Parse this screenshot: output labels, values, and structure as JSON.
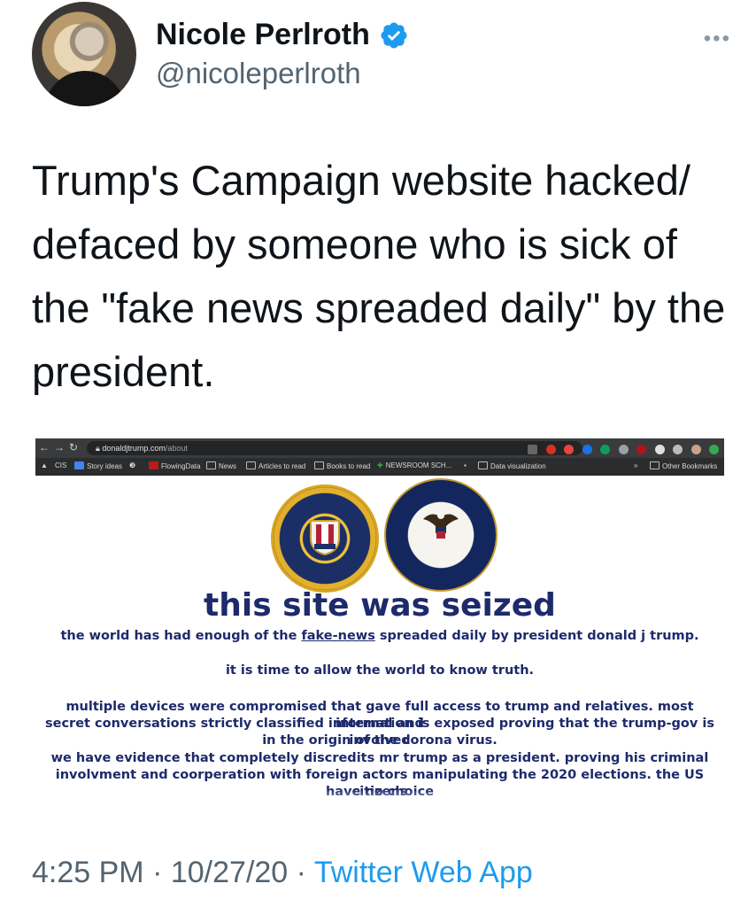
{
  "author": {
    "display_name": "Nicole Perlroth",
    "handle": "@nicoleperlroth",
    "verified": true,
    "more_menu": "•••"
  },
  "tweet": {
    "text": "Trump's Campaign website hacked/ defaced by someone who is sick of the \"fake news spreaded daily\" by the president.",
    "time": "4:25 PM",
    "date": "10/27/20",
    "separator": "·",
    "source": "Twitter Web App"
  },
  "screenshot": {
    "browser": {
      "url_domain": "donaldjtrump.com",
      "url_path": "/about",
      "bookmarks": [
        "Story ideas",
        "FlowingData",
        "News",
        "Articles to read",
        "Books to read",
        "NEWSROOM SCH...",
        "Data visualization"
      ],
      "other_bookmarks": "Other Bookmarks",
      "overflow": "»"
    },
    "seals": [
      "fbi-seal",
      "doj-seal"
    ],
    "page": {
      "headline": "this site was seized",
      "line1_before": "the world has had enough of the ",
      "line1_link": "fake-news",
      "line1_after": " spreaded daily by president donald j trump.",
      "line2": "it is time to allow the world to know truth.",
      "para_lines": [
        "multiple devices were compromised that gave full access to trump and relatives. most internal and",
        "secret conversations strictly classified information is exposed proving that the trump-gov is involved",
        "in the origin of the corona virus.",
        "we have evidence that completely discredits mr trump as a president. proving his criminal",
        "involvment and coorperation with foreign actors manipulating the 2020 elections. the US citizens",
        "have no choice"
      ]
    }
  },
  "colors": {
    "handle_gray": "#536471",
    "link_blue": "#1d9bf0",
    "verified_blue": "#1d9bf0",
    "seized_navy": "#1d2a6b"
  }
}
